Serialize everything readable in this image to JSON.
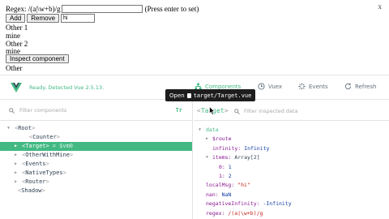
{
  "app": {
    "regex_label": "Regex: /(a|\\w+b)/g",
    "regex_value": "",
    "hint": "(Press enter to set)",
    "add_label": "Add",
    "remove_label": "Remove",
    "item_value": "hi",
    "lines": [
      "Other 1",
      "mine",
      "Other 2",
      "mine"
    ],
    "inspect_label": "Inspect component",
    "other_label": "Other",
    "corner_mark": "x"
  },
  "devtools": {
    "status": "Ready. Detected Vue 2.5.13.",
    "tabs": {
      "components": "Components",
      "vuex": "Vuex",
      "events": "Events",
      "refresh": "Refresh"
    },
    "tooltip": {
      "open": "Open",
      "path": "target/Target.vue"
    },
    "filter_components_placeholder": "Filter components",
    "select_shortcut": "Tr",
    "filter_data_placeholder": "Filter inspected data",
    "selected_component": "Target",
    "tree": {
      "root": "Root",
      "counter": "Counter",
      "target": "Target",
      "target_var": "= $vm0",
      "other_with_mine": "OtherWithMine",
      "events": "Events",
      "native_types": "NativeTypes",
      "router": "Router",
      "shadow": "Shadow"
    },
    "state": {
      "section": "data",
      "route_key": "$route",
      "infinity_key": "infinity:",
      "infinity_val": "Infinity",
      "items_key": "items:",
      "items_val": "Array[2]",
      "item0_key": "0:",
      "item0_val": "1",
      "item1_key": "1:",
      "item1_val": "2",
      "localmsg_key": "localMsg:",
      "localmsg_val": "\"hi\"",
      "nan_key": "nan:",
      "nan_val": "NaN",
      "neginf_key": "negativeInfinity:",
      "neginf_val": "-Infinity",
      "regex_key": "regex:",
      "regex_val": "/(a|\\w+b)/g"
    }
  },
  "colors": {
    "accent": "#42b983",
    "key": "#881391",
    "string": "#c41a16",
    "number": "#0a3ba6"
  }
}
